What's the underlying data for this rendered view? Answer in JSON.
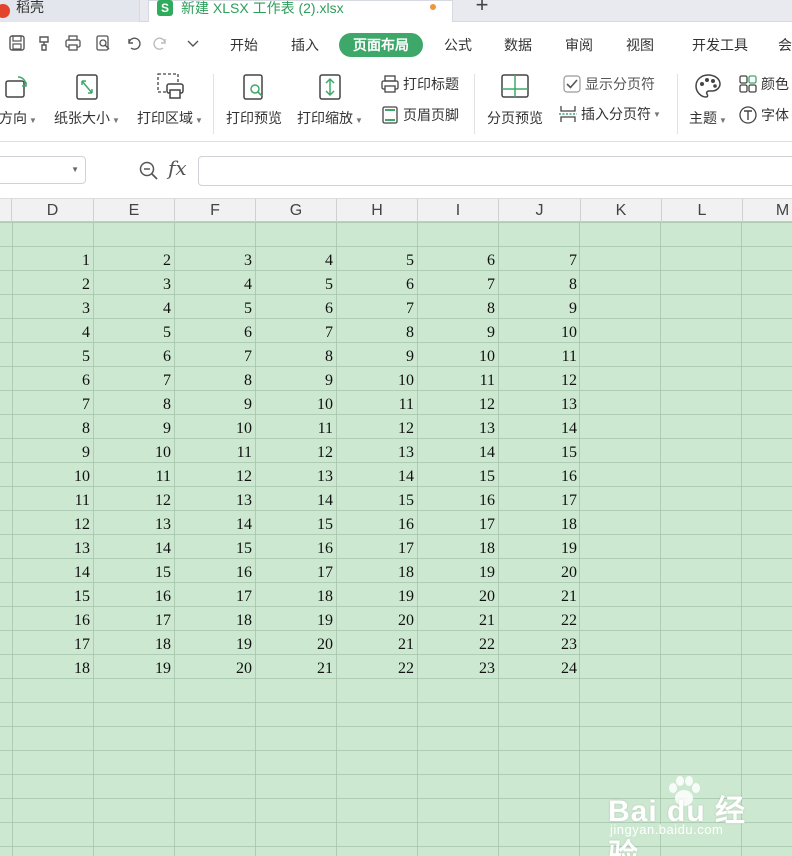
{
  "tabs": {
    "home": "稻壳",
    "document": "新建 XLSX 工作表 (2).xlsx",
    "add": "+"
  },
  "menu": {
    "items": [
      "开始",
      "插入",
      "页面布局",
      "公式",
      "数据",
      "审阅",
      "视图",
      "开发工具",
      "会"
    ],
    "active": "页面布局"
  },
  "ribbon": {
    "orientation": "方向",
    "paper_size": "纸张大小",
    "print_area": "打印区域",
    "print_preview": "打印预览",
    "print_scale": "打印缩放",
    "print_titles": "打印标题",
    "header_footer": "页眉页脚",
    "page_break_preview": "分页预览",
    "show_page_breaks": "显示分页符",
    "insert_page_break": "插入分页符",
    "theme": "主题",
    "colors": "颜色",
    "fonts": "字体"
  },
  "formula_bar": {
    "fx": "fx",
    "value": ""
  },
  "columns": [
    "D",
    "E",
    "F",
    "G",
    "H",
    "I",
    "J",
    "K",
    "L",
    "M"
  ],
  "cells": [
    [
      1,
      2,
      3,
      4,
      5,
      6,
      7
    ],
    [
      2,
      3,
      4,
      5,
      6,
      7,
      8
    ],
    [
      3,
      4,
      5,
      6,
      7,
      8,
      9
    ],
    [
      4,
      5,
      6,
      7,
      8,
      9,
      10
    ],
    [
      5,
      6,
      7,
      8,
      9,
      10,
      11
    ],
    [
      6,
      7,
      8,
      9,
      10,
      11,
      12
    ],
    [
      7,
      8,
      9,
      10,
      11,
      12,
      13
    ],
    [
      8,
      9,
      10,
      11,
      12,
      13,
      14
    ],
    [
      9,
      10,
      11,
      12,
      13,
      14,
      15
    ],
    [
      10,
      11,
      12,
      13,
      14,
      15,
      16
    ],
    [
      11,
      12,
      13,
      14,
      15,
      16,
      17
    ],
    [
      12,
      13,
      14,
      15,
      16,
      17,
      18
    ],
    [
      13,
      14,
      15,
      16,
      17,
      18,
      19
    ],
    [
      14,
      15,
      16,
      17,
      18,
      19,
      20
    ],
    [
      15,
      16,
      17,
      18,
      19,
      20,
      21
    ],
    [
      16,
      17,
      18,
      19,
      20,
      21,
      22
    ],
    [
      17,
      18,
      19,
      20,
      21,
      22,
      23
    ],
    [
      18,
      19,
      20,
      21,
      22,
      23,
      24
    ]
  ],
  "watermark": {
    "brand": "Bai du 经验",
    "url": "jingyan.baidu.com"
  },
  "colors": {
    "accent": "#3ea86a",
    "sheet_bg": "#cde8d0"
  }
}
